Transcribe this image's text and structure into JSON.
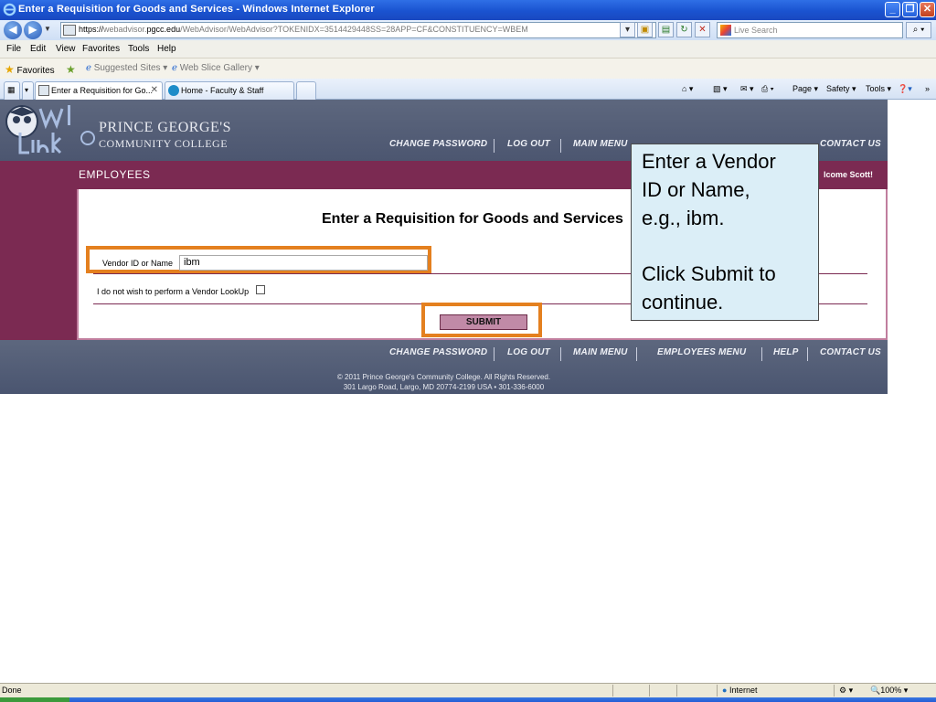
{
  "window": {
    "title": "Enter a Requisition for Goods and Services - Windows Internet Explorer",
    "minimize": "_",
    "maximize": "❐",
    "close": "✕"
  },
  "address": {
    "scheme": "https://",
    "host_pre": "webadvisor.",
    "host_bold": "pgcc.edu",
    "path": "/WebAdvisor/WebAdvisor?TOKENIDX=3514429448SS=28APP=CF&CONSTITUENCY=WBEM",
    "search_placeholder": "Live Search"
  },
  "menu": [
    "File",
    "Edit",
    "View",
    "Favorites",
    "Tools",
    "Help"
  ],
  "favorites": {
    "label": "Favorites",
    "suggested": "Suggested Sites ▾",
    "webslice": "Web Slice Gallery ▾"
  },
  "tabs": [
    {
      "label": "Enter a Requisition for Go...",
      "active": true
    },
    {
      "label": "Home - Faculty & Staff",
      "active": false
    }
  ],
  "tab_tools": {
    "page": "Page ▾",
    "safety": "Safety ▾",
    "tools": "Tools ▾"
  },
  "site": {
    "college_line1": "PRINCE GEORGE'S",
    "college_line2": "COMMUNITY COLLEGE",
    "top_nav": [
      "CHANGE PASSWORD",
      "LOG OUT",
      "MAIN MENU",
      "CONTACT US"
    ],
    "footer_nav": [
      "CHANGE PASSWORD",
      "LOG OUT",
      "MAIN MENU",
      "EMPLOYEES MENU",
      "HELP",
      "CONTACT US"
    ],
    "section": "EMPLOYEES",
    "welcome": "lcome Scott!",
    "copyright_line1": "© 2011 Prince George's Community College. All Rights Reserved.",
    "copyright_line2": "301 Largo Road, Largo, MD 20774-2199 USA • 301-336-6000"
  },
  "form": {
    "title": "Enter a Requisition for Goods and Services",
    "vendor_label": "Vendor ID or Name",
    "vendor_value": "ibm",
    "lookup_label": "I do not wish to perform a Vendor LookUp",
    "submit_label": "SUBMIT"
  },
  "callout": {
    "line1": "Enter a Vendor",
    "line2": "ID or Name,",
    "line3": "e.g., ibm.",
    "line4": "Click Submit to",
    "line5": "continue."
  },
  "status": {
    "text": "Done",
    "zone": "Internet",
    "zoom": "100%"
  },
  "colors": {
    "header_slate": "#5d677e",
    "maroon": "#7b2a52",
    "highlight_orange": "#e4801f",
    "callout_bg": "#dbeef7"
  }
}
